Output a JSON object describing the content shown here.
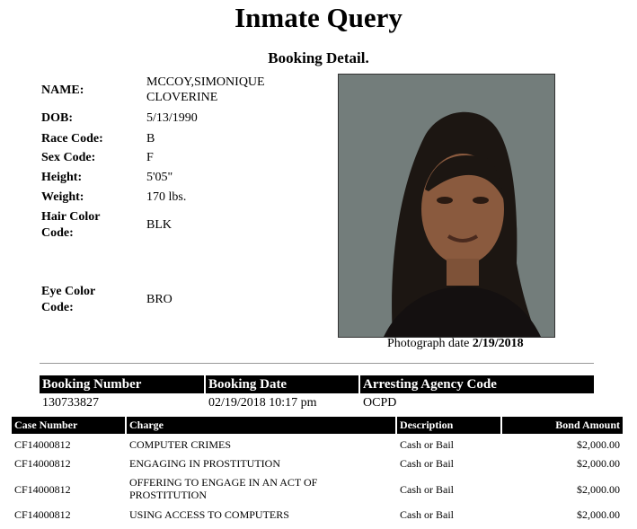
{
  "header": {
    "title": "Inmate Query",
    "subtitle": "Booking Detail."
  },
  "person": {
    "name_label": "NAME:",
    "name_line1": "MCCOY,SIMONIQUE",
    "name_line2": "CLOVERINE",
    "dob_label": "DOB:",
    "dob": "5/13/1990",
    "race_label": "Race Code:",
    "race": "B",
    "sex_label": "Sex Code:",
    "sex": "F",
    "height_label": "Height:",
    "height": "5'05\"",
    "weight_label": "Weight:",
    "weight": "170 lbs.",
    "hair_label_1": "Hair Color",
    "hair_label_2": "Code:",
    "hair": "BLK",
    "eye_label_1": "Eye Color",
    "eye_label_2": "Code:",
    "eye": "BRO"
  },
  "photo": {
    "caption_prefix": "Photograph date",
    "date": "2/19/2018"
  },
  "booking": {
    "headers": [
      "Booking Number",
      "Booking Date",
      "Arresting Agency Code"
    ],
    "values": [
      "130733827",
      "02/19/2018 10:17 pm",
      "OCPD"
    ]
  },
  "charges": {
    "headers": [
      "Case Number",
      "Charge",
      "Description",
      "Bond Amount"
    ],
    "rows": [
      {
        "case": "CF14000812",
        "charge": "COMPUTER CRIMES",
        "charge2": "",
        "desc": "Cash or Bail",
        "bond": "$2,000.00"
      },
      {
        "case": "CF14000812",
        "charge": "ENGAGING IN PROSTITUTION",
        "charge2": "",
        "desc": "Cash or Bail",
        "bond": "$2,000.00"
      },
      {
        "case": "CF14000812",
        "charge": "OFFERING TO ENGAGE IN AN ACT OF",
        "charge2": "PROSTITUTION",
        "desc": "Cash or Bail",
        "bond": "$2,000.00"
      },
      {
        "case": "CF14000812",
        "charge": "USING ACCESS TO COMPUTERS",
        "charge2": "",
        "desc": "Cash or Bail",
        "bond": "$2,000.00"
      }
    ]
  }
}
